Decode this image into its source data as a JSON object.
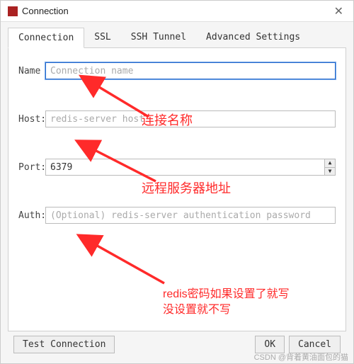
{
  "window": {
    "title": "Connection"
  },
  "tabs": [
    {
      "label": "Connection",
      "active": true
    },
    {
      "label": "SSL",
      "active": false
    },
    {
      "label": "SSH Tunnel",
      "active": false
    },
    {
      "label": "Advanced Settings",
      "active": false
    }
  ],
  "fields": {
    "name": {
      "label": "Name",
      "placeholder": "Connection name",
      "value": ""
    },
    "host": {
      "label": "Host:",
      "placeholder": "redis-server host",
      "value": ""
    },
    "port": {
      "label": "Port:",
      "value": "6379"
    },
    "auth": {
      "label": "Auth:",
      "placeholder": "(Optional) redis-server authentication password",
      "value": ""
    }
  },
  "buttons": {
    "test": "Test Connection",
    "ok": "OK",
    "cancel": "Cancel"
  },
  "annotations": {
    "name_note": "连接名称",
    "host_note": "远程服务器地址",
    "auth_note_line1": "redis密码如果设置了就写",
    "auth_note_line2": "没设置就不写"
  },
  "watermark": "CSDN @背着黄油面包的猫"
}
